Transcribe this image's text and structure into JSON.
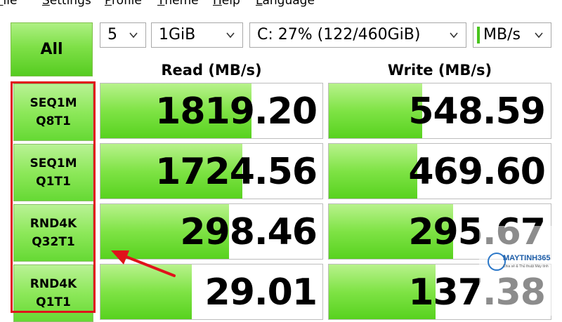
{
  "menu": [
    "File",
    "Settings",
    "Profile",
    "Theme",
    "Help",
    "Language"
  ],
  "all_button": "All",
  "selects": {
    "count": "5",
    "size": "1GiB",
    "drive": "C: 27% (122/460GiB)",
    "unit": "MB/s"
  },
  "headers": {
    "read": "Read (MB/s)",
    "write": "Write (MB/s)"
  },
  "tests": [
    {
      "line1": "SEQ1M",
      "line2": "Q8T1",
      "read": "1819.20",
      "write": "548.59",
      "read_fill": 0.68,
      "write_fill": 0.42
    },
    {
      "line1": "SEQ1M",
      "line2": "Q1T1",
      "read": "1724.56",
      "write": "469.60",
      "read_fill": 0.64,
      "write_fill": 0.4
    },
    {
      "line1": "RND4K",
      "line2": "Q32T1",
      "read": "298.46",
      "write": "295.67",
      "read_fill": 0.58,
      "write_fill": 0.56
    },
    {
      "line1": "RND4K",
      "line2": "Q1T1",
      "read": "29.01",
      "write": "137.38",
      "read_fill": 0.41,
      "write_fill": 0.48
    }
  ],
  "watermark": {
    "brand": "MAYTINH365",
    "tagline": "Chia sẻ & Thủ thuật Máy tính"
  },
  "colors": {
    "highlight": "#e0121b",
    "accent_green": "#58d21f"
  }
}
